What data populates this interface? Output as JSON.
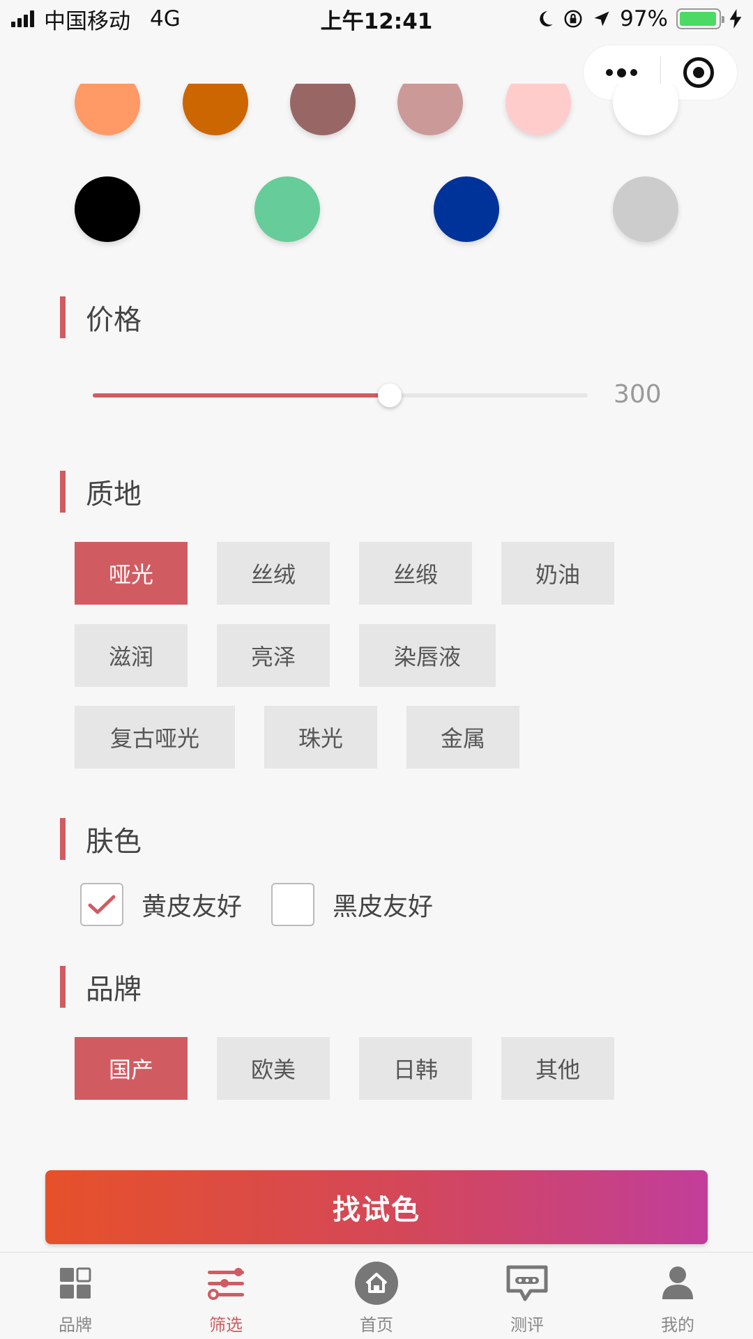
{
  "status_bar": {
    "carrier": "中国移动",
    "network": "4G",
    "time": "上午12:41",
    "battery": "97%",
    "battery_level": 0.97
  },
  "swatches": {
    "row1": [
      "#ff9966",
      "#cc6600",
      "#996666",
      "#cc9999",
      "#ffcccc",
      "#ffffff"
    ],
    "row2": [
      "#000000",
      "#66cc99",
      "#003399",
      "#cccccc"
    ]
  },
  "price": {
    "title": "价格",
    "value": "300",
    "fraction": 0.6
  },
  "texture": {
    "title": "质地",
    "options": [
      "哑光",
      "丝绒",
      "丝缎",
      "奶油",
      "滋润",
      "亮泽",
      "染唇液",
      "复古哑光",
      "珠光",
      "金属"
    ],
    "selected": "哑光"
  },
  "skin": {
    "title": "肤色",
    "options": [
      {
        "label": "黄皮友好",
        "checked": true
      },
      {
        "label": "黑皮友好",
        "checked": false
      }
    ]
  },
  "brand": {
    "title": "品牌",
    "options": [
      "国产",
      "欧美",
      "日韩",
      "其他"
    ],
    "selected": "国产"
  },
  "cta": {
    "label": "找试色"
  },
  "tabbar": {
    "items": [
      {
        "label": "品牌",
        "icon": "grid-icon"
      },
      {
        "label": "筛选",
        "icon": "sliders-icon",
        "active": true
      },
      {
        "label": "首页",
        "icon": "home-icon"
      },
      {
        "label": "测评",
        "icon": "comment-icon"
      },
      {
        "label": "我的",
        "icon": "user-icon"
      }
    ]
  }
}
